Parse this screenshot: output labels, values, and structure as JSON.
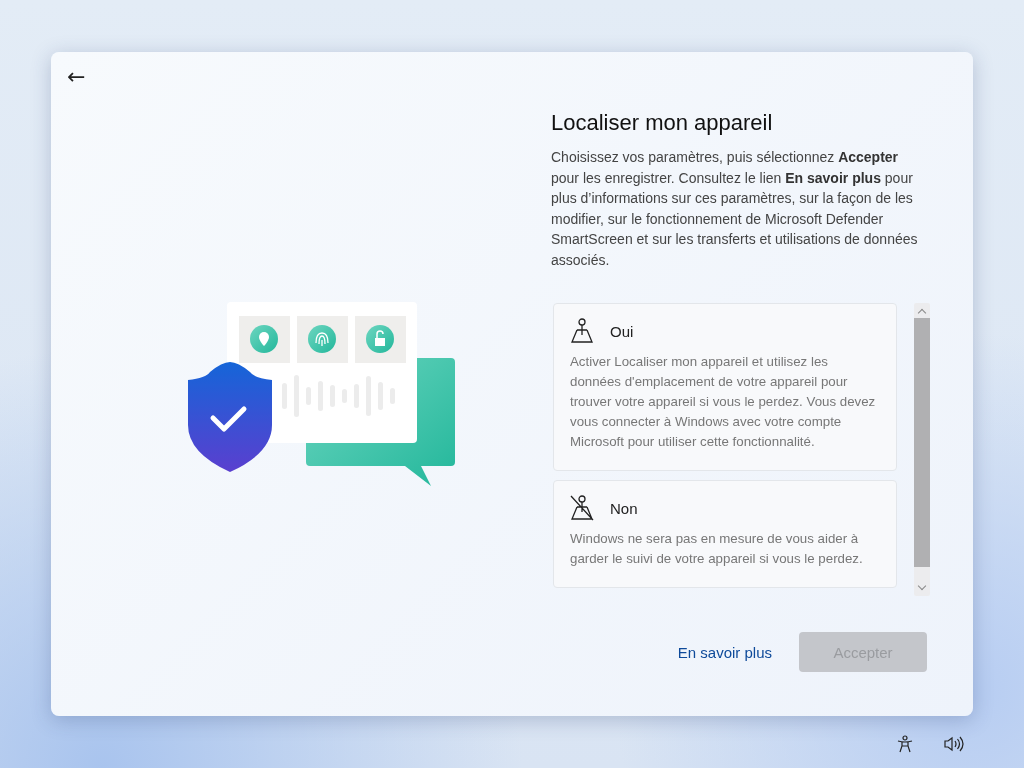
{
  "back_button": {
    "label": "←"
  },
  "title": "Localiser mon appareil",
  "description": "Choisissez vos paramètres, puis sélectionnez **Accepter** pour les enregistrer. Consultez le lien **En savoir plus** pour plus d’informations sur ces paramètres, sur la façon de les modifier, sur le fonctionnement de Microsoft Defender SmartScreen et sur les transferts et utilisations de données associés.",
  "options": [
    {
      "kind": "on",
      "label": "Oui",
      "text": "Activer Localiser mon appareil et utilisez les données d'emplacement de votre appareil pour trouver votre appareil si vous le perdez. Vous devez vous connecter à Windows avec votre compte Microsoft pour utiliser cette fonctionnalité.",
      "selected": false
    },
    {
      "kind": "off",
      "label": "Non",
      "text": "Windows ne sera pas en mesure de vous aider à garder le suivi de votre appareil si vous le perdez.",
      "selected": false
    }
  ],
  "learn_more_link": "En savoir plus",
  "accept_button": {
    "label": "Accepter",
    "disabled": true
  }
}
